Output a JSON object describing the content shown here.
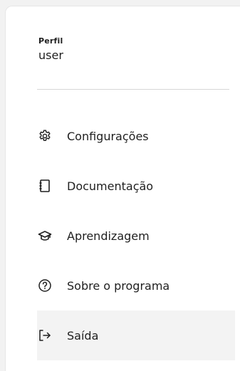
{
  "profile": {
    "label": "Perfil",
    "username": "user"
  },
  "menu": {
    "items": [
      {
        "label": "Configurações",
        "icon": "gear-icon"
      },
      {
        "label": "Documentação",
        "icon": "document-icon"
      },
      {
        "label": "Aprendizagem",
        "icon": "graduation-cap-icon"
      },
      {
        "label": "Sobre o programa",
        "icon": "question-circle-icon"
      },
      {
        "label": "Saída",
        "icon": "logout-icon",
        "highlighted": true
      }
    ]
  },
  "colors": {
    "text": "#1f1f1f",
    "highlight_background": "#f3f3f3",
    "divider": "#d6d6d6"
  }
}
